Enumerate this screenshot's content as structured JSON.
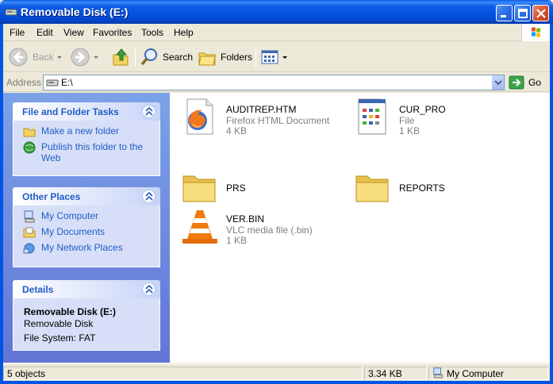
{
  "window": {
    "title": "Removable Disk (E:)"
  },
  "menu": [
    "File",
    "Edit",
    "View",
    "Favorites",
    "Tools",
    "Help"
  ],
  "toolbar": {
    "back_label": "Back",
    "search_label": "Search",
    "folders_label": "Folders"
  },
  "address": {
    "label": "Address",
    "value": "E:\\",
    "go_label": "Go"
  },
  "taskpane": {
    "file_tasks": {
      "title": "File and Folder Tasks",
      "items": [
        "Make a new folder",
        "Publish this folder to the Web"
      ]
    },
    "other_places": {
      "title": "Other Places",
      "items": [
        "My Computer",
        "My Documents",
        "My Network Places"
      ]
    },
    "details": {
      "title": "Details",
      "name": "Removable Disk (E:)",
      "type": "Removable Disk",
      "filesystem": "File System: FAT"
    }
  },
  "files": [
    {
      "name": "AUDITREP.HTM",
      "type": "Firefox HTML Document",
      "size": "4 KB",
      "icon": "firefox-html-icon"
    },
    {
      "name": "CUR_PRO",
      "type": "File",
      "size": "1 KB",
      "icon": "generic-file-icon"
    },
    {
      "name": "PRS",
      "type": "",
      "size": "",
      "icon": "folder-icon"
    },
    {
      "name": "REPORTS",
      "type": "",
      "size": "",
      "icon": "folder-icon"
    },
    {
      "name": "VER.BIN",
      "type": "VLC media file (.bin)",
      "size": "1 KB",
      "icon": "vlc-cone-icon"
    }
  ],
  "status": {
    "objects": "5 objects",
    "size": "3.34 KB",
    "location": "My Computer"
  },
  "colors": {
    "titlebar": "#0551df",
    "task_link": "#215dc6",
    "taskpane_bg": "#7ba2e7"
  }
}
